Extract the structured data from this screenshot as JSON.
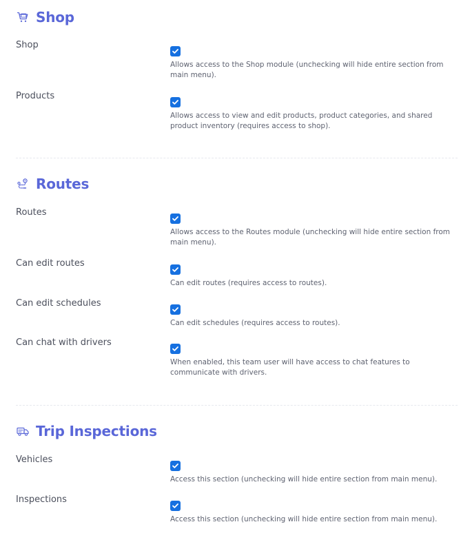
{
  "sections": [
    {
      "title": "Shop",
      "icon": "shop-cart-icon",
      "rows": [
        {
          "label": "Shop",
          "checked": true,
          "description": "Allows access to the Shop module (unchecking will hide entire section from main menu)."
        },
        {
          "label": "Products",
          "checked": true,
          "description": "Allows access to view and edit products, product categories, and shared product inventory (requires access to shop)."
        }
      ]
    },
    {
      "title": "Routes",
      "icon": "routes-icon",
      "rows": [
        {
          "label": "Routes",
          "checked": true,
          "description": "Allows access to the Routes module (unchecking will hide entire section from main menu)."
        },
        {
          "label": "Can edit routes",
          "checked": true,
          "description": "Can edit routes (requires access to routes)."
        },
        {
          "label": "Can edit schedules",
          "checked": true,
          "description": "Can edit schedules (requires access to routes)."
        },
        {
          "label": "Can chat with drivers",
          "checked": true,
          "description": "When enabled, this team user will have access to chat features to communicate with drivers."
        }
      ]
    },
    {
      "title": "Trip Inspections",
      "icon": "truck-icon",
      "rows": [
        {
          "label": "Vehicles",
          "checked": true,
          "description": "Access this section (unchecking will hide entire section from main menu)."
        },
        {
          "label": "Inspections",
          "checked": true,
          "description": "Access this section (unchecking will hide entire section from main menu)."
        }
      ]
    }
  ],
  "colors": {
    "accent": "#5a67d8",
    "checkbox": "#1670e0",
    "label": "#4b4f5c",
    "description": "#5e6270",
    "divider": "#e6e8ee"
  }
}
